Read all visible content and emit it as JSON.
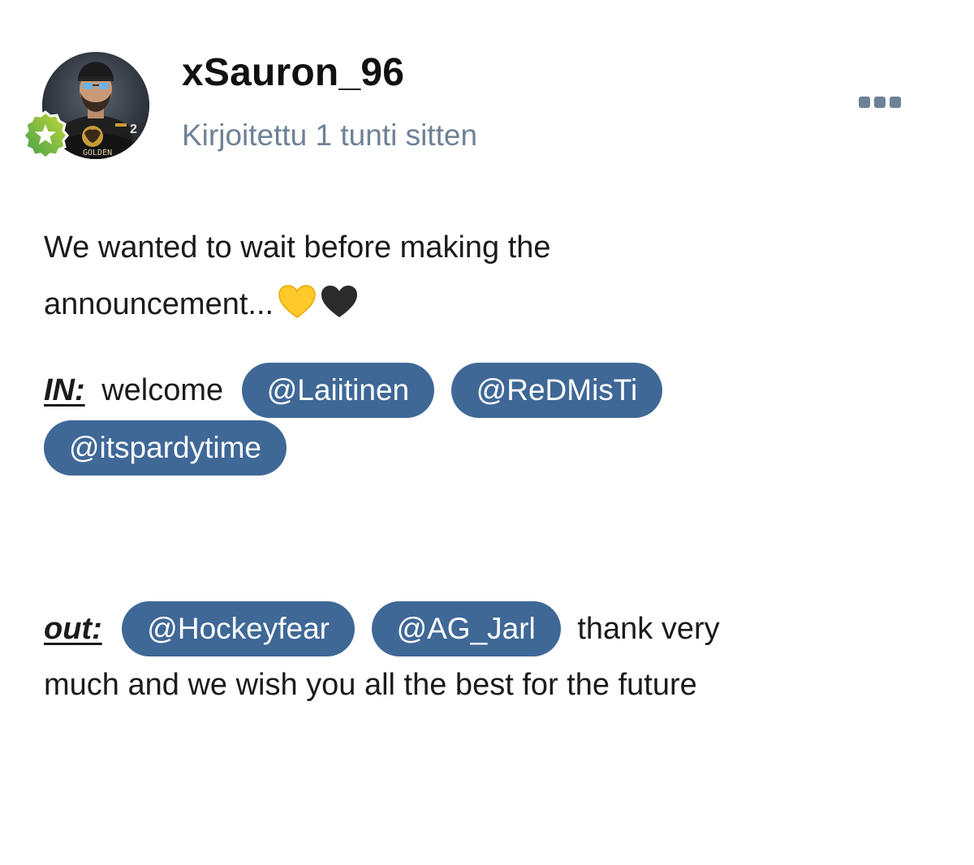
{
  "post": {
    "author": {
      "username": "xSauron_96",
      "avatar_icon": "avatar-hockey-player-golden-bison-jersey",
      "badge_icon": "star-rank-badge-icon",
      "jersey_text": "GOLDEN"
    },
    "timestamp": "Kirjoitettu 1 tunti sitten",
    "menu_icon": "more-options-icon",
    "body": {
      "line1": "We wanted to wait before making the",
      "line2": "announcement...",
      "emojis": [
        "yellow-heart",
        "black-heart"
      ],
      "in_label": "IN:",
      "in_text": "welcome",
      "in_mentions": [
        "@Laiitinen",
        "@ReDMisTi",
        "@itspardytime"
      ],
      "out_label": "out:",
      "out_mentions": [
        "@Hockeyfear",
        "@AG_Jarl"
      ],
      "out_text": "thank very",
      "out_text2": "much and we wish you all the best for the future"
    },
    "colors": {
      "mention_bg": "#3f6897",
      "muted_text": "#6e8196",
      "badge_green": "#4caf50",
      "badge_yellow": "#c7d93b"
    }
  }
}
